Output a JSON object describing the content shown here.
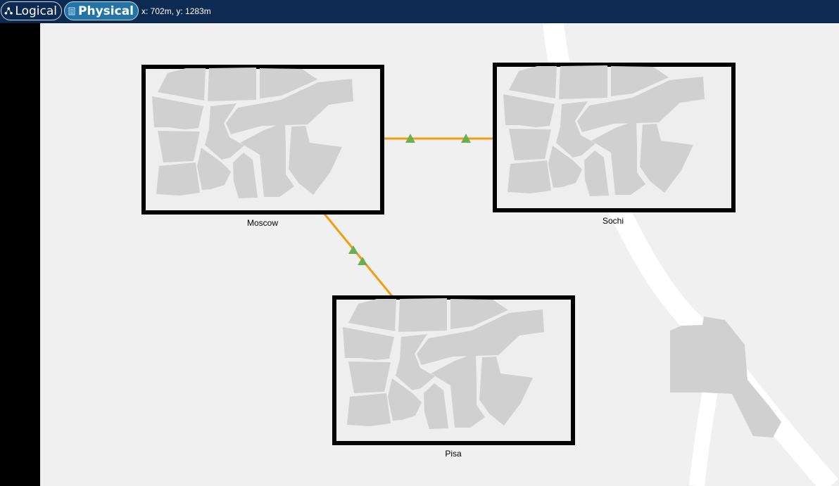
{
  "toolbar": {
    "logical_label": "Logical",
    "physical_label": "Physical",
    "active_view": "Physical",
    "coords_text": "x: 702m, y: 1283m"
  },
  "icons": {
    "logical": "topology-nodes-icon",
    "physical": "building-list-icon"
  },
  "colors": {
    "toolbar_bg": "#0d2a52",
    "active_button_bg": "#2273a8",
    "link_color": "#f39c12",
    "arrow_color": "#6ab04c",
    "node_frame": "#000000",
    "city_blocks": "#d0d0d0",
    "map_bg": "#f0f0f0",
    "road": "#ffffff"
  },
  "nodes": [
    {
      "id": "moscow",
      "label": "Moscow"
    },
    {
      "id": "sochi",
      "label": "Sochi"
    },
    {
      "id": "pisa",
      "label": "Pisa"
    }
  ],
  "links": [
    {
      "from": "Moscow",
      "to": "Sochi"
    },
    {
      "from": "Moscow",
      "to": "Pisa"
    }
  ]
}
